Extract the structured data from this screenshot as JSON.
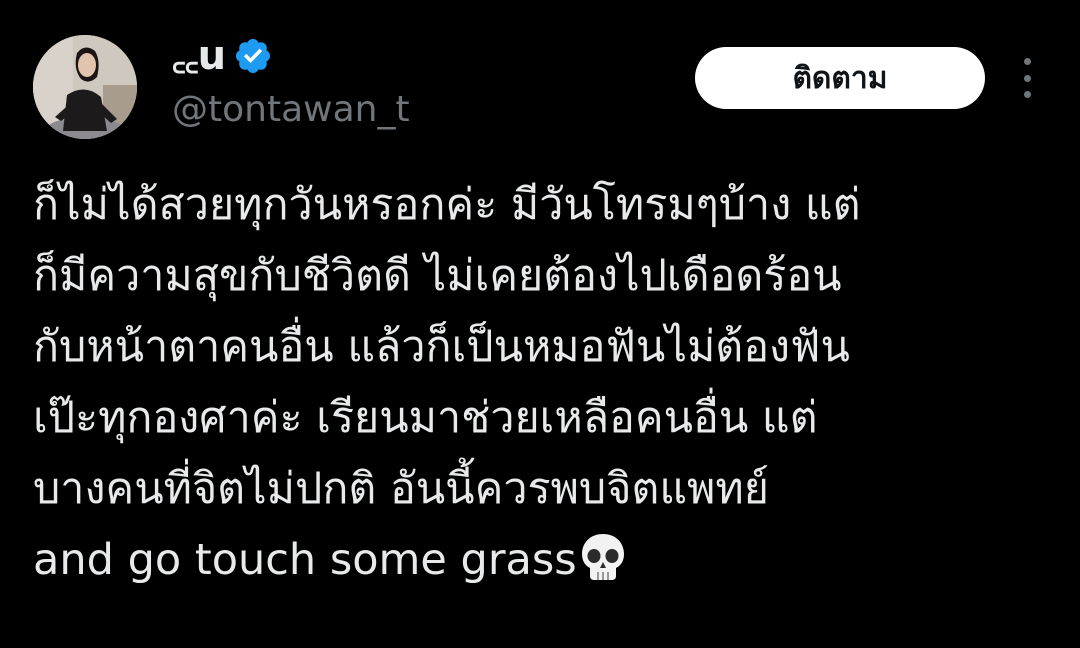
{
  "author": {
    "display_name": "꜀꜀u",
    "handle": "@tontawan_t",
    "verified": true,
    "verified_color": "#1d9bf0",
    "avatar": "profile-photo"
  },
  "actions": {
    "follow_label": "ติดตาม",
    "more_icon": "more-vertical-icon"
  },
  "tweet": {
    "lines": [
      "ก็ไม่ได้สวยทุกวันหรอกค่ะ มีวันโทรมๆบ้าง แต่",
      "ก็มีความสุขกับชีวิตดี ไม่เคยต้องไปเดือดร้อน",
      "กับหน้าตาคนอื่น แล้วก็เป็นหมอฟันไม่ต้องฟัน",
      "เป๊ะทุกองศาค่ะ เรียนมาช่วยเหลือคนอื่น แต่",
      "บางคนที่จิตไม่ปกติ อันนี้ควรพบจิตแพทย์",
      "and go touch some grass"
    ],
    "emoji": "skull-emoji"
  },
  "colors": {
    "background": "#000000",
    "text": "#e7e9ea",
    "secondary_text": "#71767b",
    "button_bg": "#ffffff",
    "button_text": "#0f1419"
  }
}
